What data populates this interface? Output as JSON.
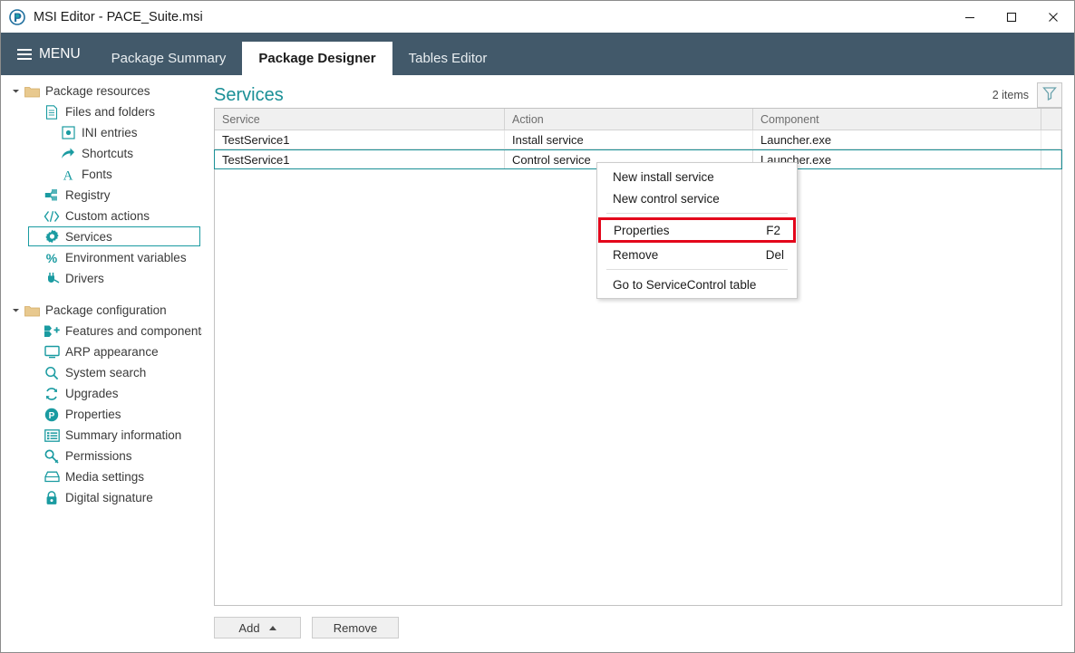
{
  "window": {
    "title": "MSI Editor - PACE_Suite.msi",
    "app_icon": "pace-logo-icon",
    "controls": [
      {
        "name": "minimize-button",
        "glyph": "minimize"
      },
      {
        "name": "maximize-button",
        "glyph": "maximize"
      },
      {
        "name": "close-button",
        "glyph": "close"
      }
    ]
  },
  "header": {
    "menu_label": "MENU",
    "tabs": [
      {
        "label": "Package Summary",
        "active": false
      },
      {
        "label": "Package Designer",
        "active": true
      },
      {
        "label": "Tables Editor",
        "active": false
      }
    ]
  },
  "sidebar": {
    "groups": [
      {
        "label": "Package resources",
        "icon": "folder-icon",
        "expanded": true,
        "items": [
          {
            "label": "Files and folders",
            "icon": "document-icon",
            "indent": 1,
            "selected": false
          },
          {
            "label": "INI entries",
            "icon": "ini-file-icon",
            "indent": 2,
            "selected": false
          },
          {
            "label": "Shortcuts",
            "icon": "shortcut-arrow-icon",
            "indent": 2,
            "selected": false
          },
          {
            "label": "Fonts",
            "icon": "font-a-icon",
            "indent": 2,
            "selected": false
          },
          {
            "label": "Registry",
            "icon": "registry-blocks-icon",
            "indent": 1,
            "selected": false
          },
          {
            "label": "Custom actions",
            "icon": "code-brackets-icon",
            "indent": 1,
            "selected": false
          },
          {
            "label": "Services",
            "icon": "gear-icon",
            "indent": 1,
            "selected": true
          },
          {
            "label": "Environment variables",
            "icon": "percent-icon",
            "indent": 1,
            "selected": false
          },
          {
            "label": "Drivers",
            "icon": "plug-icon",
            "indent": 1,
            "selected": false
          }
        ]
      },
      {
        "label": "Package configuration",
        "icon": "folder-icon",
        "expanded": true,
        "items": [
          {
            "label": "Features and components",
            "icon": "features-icon",
            "indent": 1,
            "selected": false
          },
          {
            "label": "ARP appearance",
            "icon": "monitor-icon",
            "indent": 1,
            "selected": false
          },
          {
            "label": "System search",
            "icon": "search-icon",
            "indent": 1,
            "selected": false
          },
          {
            "label": "Upgrades",
            "icon": "refresh-icon",
            "indent": 1,
            "selected": false
          },
          {
            "label": "Properties",
            "icon": "property-p-icon",
            "indent": 1,
            "selected": false
          },
          {
            "label": "Summary information",
            "icon": "list-icon",
            "indent": 1,
            "selected": false
          },
          {
            "label": "Permissions",
            "icon": "key-icon",
            "indent": 1,
            "selected": false
          },
          {
            "label": "Media settings",
            "icon": "media-disk-icon",
            "indent": 1,
            "selected": false
          },
          {
            "label": "Digital signature",
            "icon": "lock-icon",
            "indent": 1,
            "selected": false
          }
        ]
      }
    ]
  },
  "main": {
    "page_title": "Services",
    "items_count": "2 items",
    "filter_icon": "filter-funnel-icon",
    "table": {
      "columns": [
        "Service",
        "Action",
        "Component",
        ""
      ],
      "rows": [
        {
          "cells": [
            "TestService1",
            "Install service",
            "Launcher.exe",
            ""
          ],
          "selected": false
        },
        {
          "cells": [
            "TestService1",
            "Control service",
            "Launcher.exe",
            ""
          ],
          "selected": true
        }
      ]
    },
    "footer_buttons": [
      {
        "label": "Add",
        "name": "add-button",
        "has_caret": true
      },
      {
        "label": "Remove",
        "name": "remove-button",
        "has_caret": false
      }
    ]
  },
  "context_menu": {
    "items": [
      {
        "label": "New install service",
        "shortcut": "",
        "type": "item",
        "highlight": false
      },
      {
        "label": "New control service",
        "shortcut": "",
        "type": "item",
        "highlight": false
      },
      {
        "type": "separator"
      },
      {
        "label": "Properties",
        "shortcut": "F2",
        "type": "item",
        "highlight": true
      },
      {
        "label": "Remove",
        "shortcut": "Del",
        "type": "item",
        "highlight": false
      },
      {
        "type": "separator"
      },
      {
        "label": "Go to ServiceControl table",
        "shortcut": "",
        "type": "item",
        "highlight": false
      }
    ]
  },
  "colors": {
    "header_bar": "#42596a",
    "accent_teal": "#1a9ba1",
    "title_teal": "#1a8f96",
    "highlight_red": "#e3061b",
    "folder_tan": "#e8c98f"
  }
}
